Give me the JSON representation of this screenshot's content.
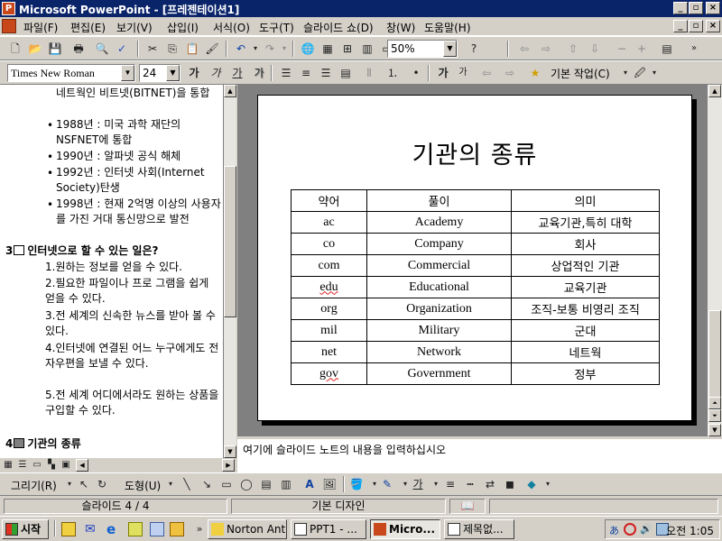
{
  "window": {
    "title": "Microsoft PowerPoint - [프레젠테이션1]",
    "app_icon": "P"
  },
  "menu": [
    "파일(F)",
    "편집(E)",
    "보기(V)",
    "삽입(I)",
    "서식(O)",
    "도구(T)",
    "슬라이드 쇼(D)",
    "창(W)",
    "도움말(H)"
  ],
  "toolbar": {
    "zoom": "50%",
    "font_name": "Times New Roman",
    "font_size": "24",
    "design_label": "기본 작업(C)",
    "format_buttons": [
      "가",
      "가",
      "가",
      "가"
    ]
  },
  "outline": {
    "top_lines": [
      {
        "text": "네트웍인 비트넷(BITNET)을 통합",
        "bullet": false
      },
      {
        "text": "1988년 : 미국 과학 재단의 NSFNET에 통합",
        "bullet": true
      },
      {
        "text": "1990년 : 알파넷 공식 해체",
        "bullet": true
      },
      {
        "text": "1992년 : 인터넷 사회(Internet Society)탄생",
        "bullet": true
      },
      {
        "text": "1998년 : 현재 2억명 이상의 사용자를 가진 거대 통신망으로 발전",
        "bullet": true
      }
    ],
    "slide3": {
      "number": "3",
      "title": "인터넷으로 할 수 있는 일은?",
      "items": [
        "1.원하는 정보를 얻을 수 있다.",
        "2.필요한  파일이나 프로 그램을 쉽게 얻을 수 있다.",
        "3.전 세계의 신속한 뉴스를 받아 볼 수 있다.",
        "4.인터넷에 연결된 어느 누구에게도 전자우편을 보낼 수 있다.",
        "5.전 세계 어디에서라도 원하는 상품을 구입할 수 있다."
      ]
    },
    "slide4": {
      "number": "4",
      "title": "기관의 종류"
    }
  },
  "slide": {
    "title": "기관의 종류",
    "table": {
      "headers": [
        "약어",
        "풀이",
        "의미"
      ],
      "rows": [
        [
          "ac",
          "Academy",
          "교육기관,특히 대학"
        ],
        [
          "co",
          "Company",
          "회사"
        ],
        [
          "com",
          "Commercial",
          "상업적인 기관"
        ],
        [
          "edu",
          "Educational",
          "교육기관"
        ],
        [
          "org",
          "Organization",
          "조직-보통 비영리 조직"
        ],
        [
          "mil",
          "Military",
          "군대"
        ],
        [
          "net",
          "Network",
          "네트웍"
        ],
        [
          "gov",
          "Government",
          "정부"
        ]
      ]
    }
  },
  "notes": {
    "placeholder": "여기에 슬라이드 노트의 내용을 입력하십시오"
  },
  "drawbar": {
    "draw_label": "그리기(R)",
    "autoshape_label": "도형(U)"
  },
  "status": {
    "slide_counter": "슬라이드 4 / 4",
    "design": "기본 디자인"
  },
  "taskbar": {
    "start": "시작",
    "tasks": [
      "Norton Anti...",
      "PPT1 - ...",
      "Micro...",
      "제목없..."
    ],
    "clock": "오전 1:05"
  },
  "colors": {
    "titlebar": "#0a246a",
    "chrome": "#d4d0c8",
    "slide_bg": "#ffffff",
    "workspace": "#808080"
  }
}
